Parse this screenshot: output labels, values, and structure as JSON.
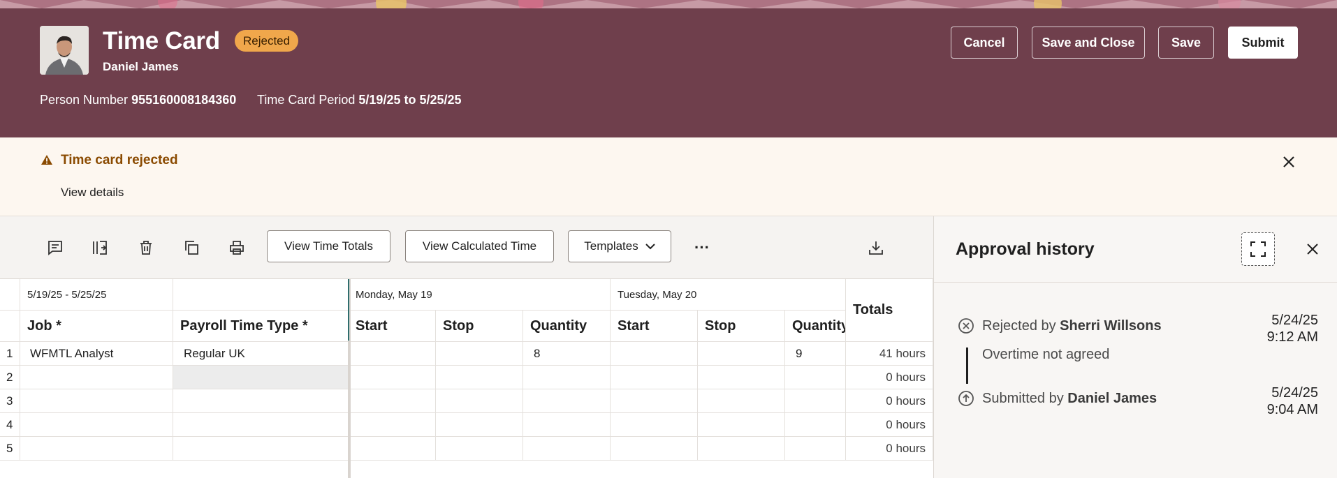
{
  "header": {
    "title": "Time Card",
    "status_badge": "Rejected",
    "employee_name": "Daniel James",
    "person_number_label": "Person Number",
    "person_number": "955160008184360",
    "period_label": "Time Card Period",
    "period_value": "5/19/25 to 5/25/25",
    "buttons": {
      "cancel": "Cancel",
      "save_close": "Save and Close",
      "save": "Save",
      "submit": "Submit"
    }
  },
  "banner": {
    "title": "Time card rejected",
    "link": "View details"
  },
  "toolbar": {
    "icons": [
      "comment-icon",
      "split-column-icon",
      "delete-icon",
      "copy-icon",
      "print-icon"
    ],
    "view_time_totals": "View Time Totals",
    "view_calculated_time": "View Calculated Time",
    "templates": "Templates",
    "more": "···",
    "download_icon": "download-icon"
  },
  "grid": {
    "date_range": "5/19/25 - 5/25/25",
    "days": [
      "Monday, May 19",
      "Tuesday, May 20"
    ],
    "totals_header": "Totals",
    "columns": {
      "job": "Job *",
      "payroll_type": "Payroll Time Type *",
      "start": "Start",
      "stop": "Stop",
      "quantity": "Quantity",
      "quantity_cut": "Quantity"
    },
    "rows": [
      {
        "num": "1",
        "job": "WFMTL Analyst",
        "type": "Regular UK",
        "mon_qty": "8",
        "tue_qty": "9",
        "total": "41 hours"
      },
      {
        "num": "2",
        "job": "",
        "type": "",
        "mon_qty": "",
        "tue_qty": "",
        "total": "0 hours"
      },
      {
        "num": "3",
        "job": "",
        "type": "",
        "mon_qty": "",
        "tue_qty": "",
        "total": "0 hours"
      },
      {
        "num": "4",
        "job": "",
        "type": "",
        "mon_qty": "",
        "tue_qty": "",
        "total": "0 hours"
      },
      {
        "num": "5",
        "job": "",
        "type": "",
        "mon_qty": "",
        "tue_qty": "",
        "total": "0 hours"
      }
    ]
  },
  "approval": {
    "title": "Approval history",
    "entries": [
      {
        "prefix": "Rejected by ",
        "name": "Sherri Willsons",
        "comment": "Overtime not agreed",
        "date": "5/24/25",
        "time": "9:12 AM",
        "icon": "rejected-circle-icon"
      },
      {
        "prefix": "Submitted by ",
        "name": "Daniel James",
        "comment": "",
        "date": "5/24/25",
        "time": "9:04 AM",
        "icon": "submitted-arrow-circle-icon"
      }
    ]
  },
  "colors": {
    "header_bg": "#6f3f4c",
    "badge_bg": "#f0a74b",
    "warning_text": "#8a4a00",
    "banner_bg": "#fdf7f0"
  }
}
